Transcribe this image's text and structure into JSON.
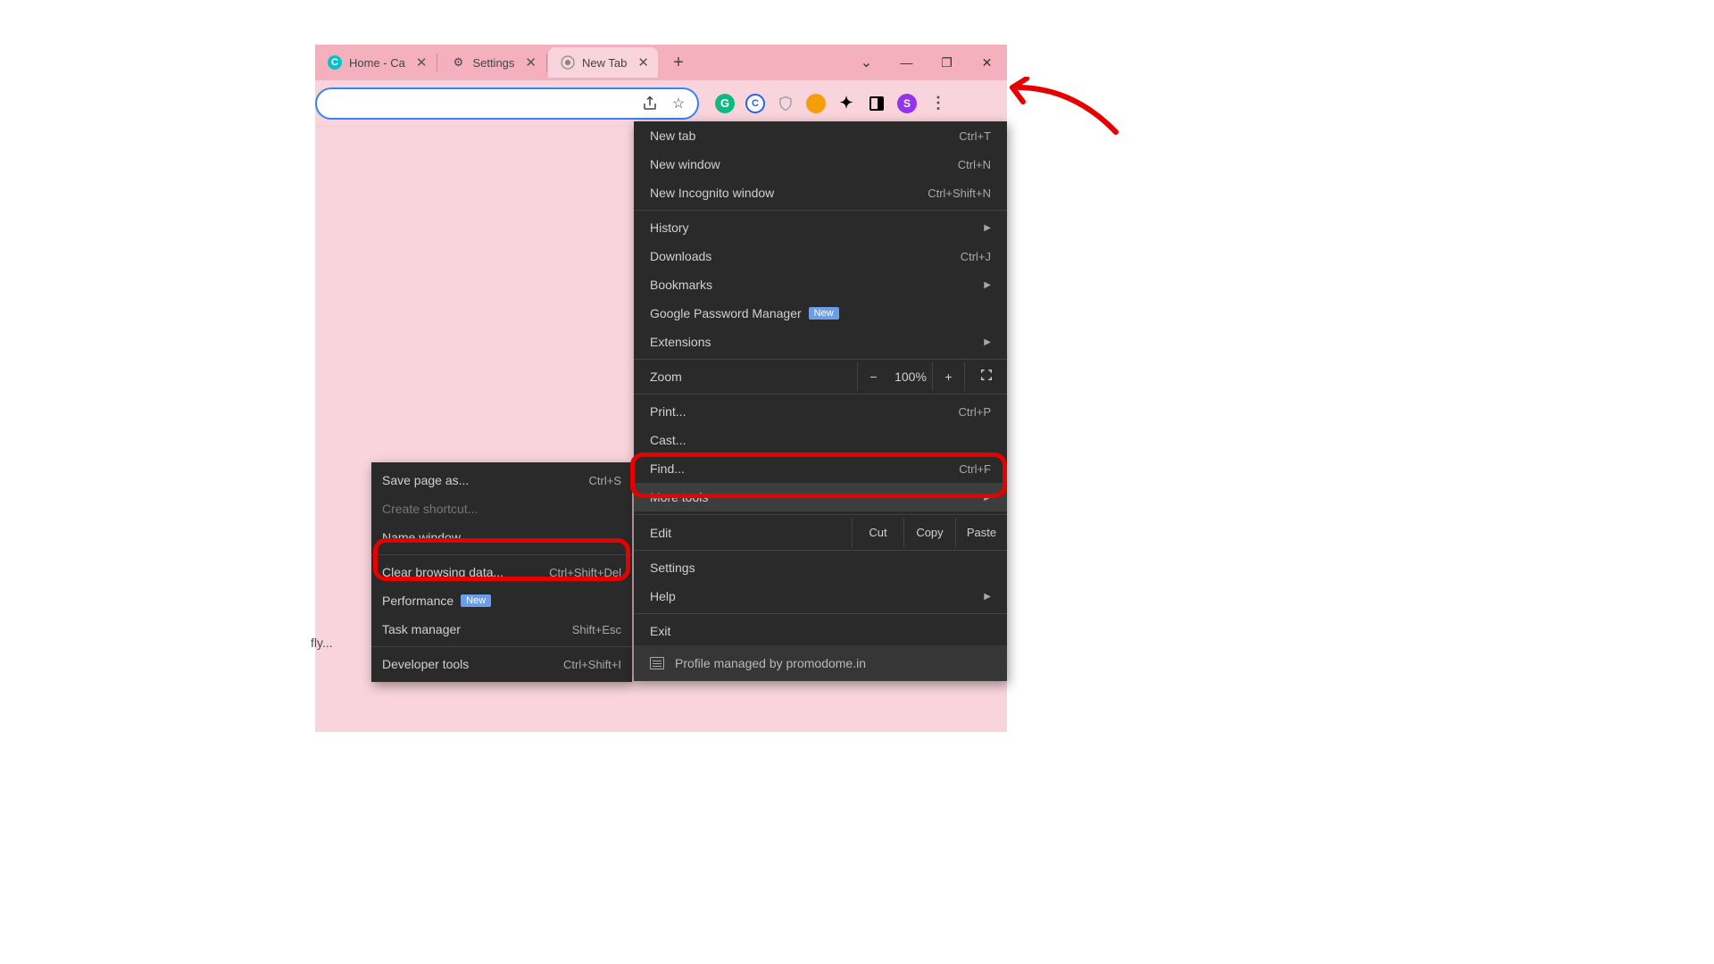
{
  "tabs": [
    {
      "title": "Home - Ca",
      "favicon_color": "#3b82f6",
      "favicon_letter": "C"
    },
    {
      "title": "Settings",
      "favicon": "gear"
    },
    {
      "title": "New Tab",
      "favicon": "chrome"
    }
  ],
  "window_controls": {
    "dropdown": "⌄",
    "minimize": "—",
    "maximize": "❐",
    "close": "✕"
  },
  "profile_letter": "S",
  "main_menu": {
    "new_tab": {
      "label": "New tab",
      "shortcut": "Ctrl+T"
    },
    "new_window": {
      "label": "New window",
      "shortcut": "Ctrl+N"
    },
    "new_incognito": {
      "label": "New Incognito window",
      "shortcut": "Ctrl+Shift+N"
    },
    "history": {
      "label": "History"
    },
    "downloads": {
      "label": "Downloads",
      "shortcut": "Ctrl+J"
    },
    "bookmarks": {
      "label": "Bookmarks"
    },
    "password_manager": {
      "label": "Google Password Manager",
      "badge": "New"
    },
    "extensions": {
      "label": "Extensions"
    },
    "zoom": {
      "label": "Zoom",
      "pct": "100%",
      "minus": "−",
      "plus": "+"
    },
    "print": {
      "label": "Print...",
      "shortcut": "Ctrl+P"
    },
    "cast": {
      "label": "Cast..."
    },
    "find": {
      "label": "Find...",
      "shortcut": "Ctrl+F"
    },
    "more_tools": {
      "label": "More tools"
    },
    "edit": {
      "label": "Edit",
      "cut": "Cut",
      "copy": "Copy",
      "paste": "Paste"
    },
    "settings": {
      "label": "Settings"
    },
    "help": {
      "label": "Help"
    },
    "exit": {
      "label": "Exit"
    },
    "profile_footer": "Profile managed by promodome.in"
  },
  "submenu": {
    "save_page": {
      "label": "Save page as...",
      "shortcut": "Ctrl+S"
    },
    "create_shortcut": {
      "label": "Create shortcut..."
    },
    "name_window": {
      "label": "Name window..."
    },
    "clear_data": {
      "label": "Clear browsing data...",
      "shortcut": "Ctrl+Shift+Del"
    },
    "performance": {
      "label": "Performance",
      "badge": "New"
    },
    "task_manager": {
      "label": "Task manager",
      "shortcut": "Shift+Esc"
    },
    "developer_tools": {
      "label": "Developer tools",
      "shortcut": "Ctrl+Shift+I"
    }
  },
  "stray_text": "fly..."
}
